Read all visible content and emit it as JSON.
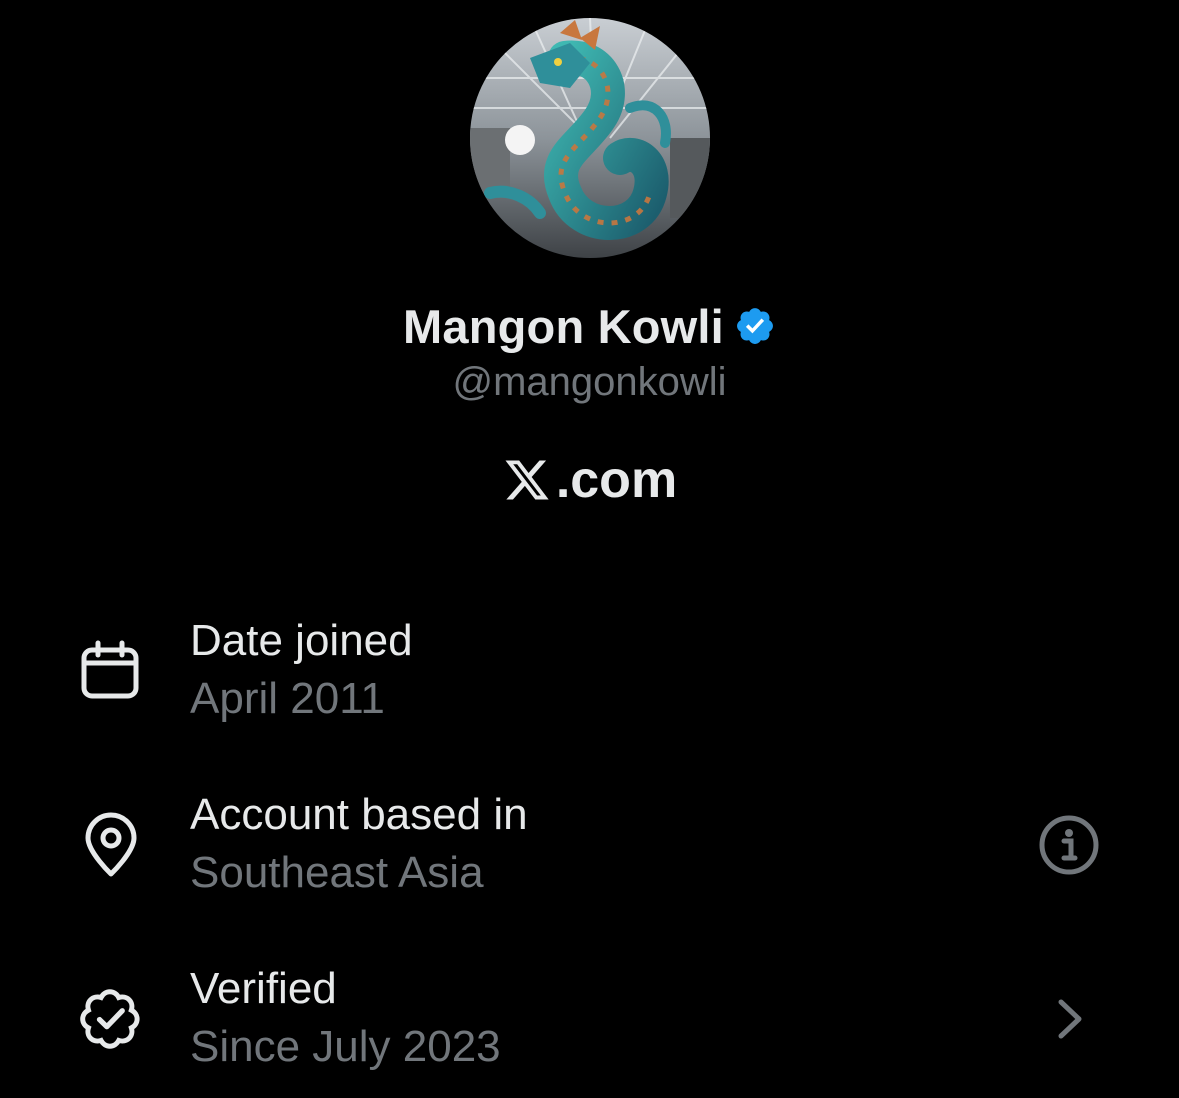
{
  "profile": {
    "display_name": "Mangon Kowli",
    "handle": "@mangonkowli",
    "verified": true,
    "avatar_description": "dragon-sculpture-avatar"
  },
  "brand": {
    "icon": "x-logo-icon",
    "text": ".com"
  },
  "rows": [
    {
      "icon": "calendar-icon",
      "label": "Date joined",
      "value": "April 2011",
      "action": null
    },
    {
      "icon": "location-pin-icon",
      "label": "Account based in",
      "value": "Southeast Asia",
      "action": "info-icon"
    },
    {
      "icon": "verified-badge-outline-icon",
      "label": "Verified",
      "value": "Since July 2023",
      "action": "chevron-right-icon"
    }
  ],
  "colors": {
    "background": "#000000",
    "primary_text": "#e7e9ea",
    "secondary_text": "#71767b",
    "verified_blue": "#1d9bf0"
  }
}
